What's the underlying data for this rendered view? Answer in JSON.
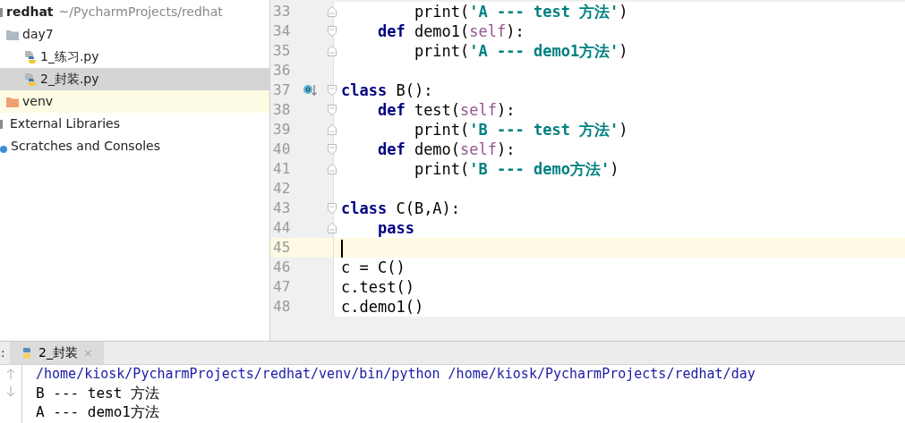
{
  "project_tree": {
    "root": {
      "name": "redhat",
      "path": "~/PycharmProjects/redhat"
    },
    "items": [
      {
        "kind": "folder",
        "label": "day7",
        "selected": false,
        "children": [
          {
            "kind": "python-file",
            "label": "1_练习.py",
            "selected": false
          },
          {
            "kind": "python-file",
            "label": "2_封装.py",
            "selected": true
          }
        ]
      },
      {
        "kind": "excluded-folder",
        "label": "venv",
        "selected": false
      },
      {
        "kind": "libraries",
        "label": "External Libraries",
        "selected": false
      },
      {
        "kind": "scratches",
        "label": "Scratches and Consoles",
        "selected": false
      }
    ]
  },
  "editor": {
    "lines": [
      {
        "number": "33",
        "fold_start": false,
        "fold_end": true,
        "current": false,
        "override": false,
        "tokens": [
          {
            "kind": "plain",
            "text": "        print("
          },
          {
            "kind": "string",
            "text": "'A --- test 方法'"
          },
          {
            "kind": "plain",
            "text": ")"
          }
        ]
      },
      {
        "number": "34",
        "fold_start": true,
        "fold_end": false,
        "current": false,
        "override": false,
        "tokens": [
          {
            "kind": "keyword",
            "text": "    def"
          },
          {
            "kind": "plain",
            "text": " demo1("
          },
          {
            "kind": "self",
            "text": "self"
          },
          {
            "kind": "plain",
            "text": "):"
          }
        ]
      },
      {
        "number": "35",
        "fold_start": false,
        "fold_end": true,
        "current": false,
        "override": false,
        "tokens": [
          {
            "kind": "plain",
            "text": "        print("
          },
          {
            "kind": "string",
            "text": "'A --- demo1方法'"
          },
          {
            "kind": "plain",
            "text": ")"
          }
        ]
      },
      {
        "number": "36",
        "fold_start": false,
        "fold_end": false,
        "current": false,
        "override": false
      },
      {
        "number": "37",
        "fold_start": true,
        "fold_end": false,
        "current": false,
        "override": true,
        "tokens": [
          {
            "kind": "keyword",
            "text": "class"
          },
          {
            "kind": "plain",
            "text": " B():"
          }
        ]
      },
      {
        "number": "38",
        "fold_start": true,
        "fold_end": false,
        "current": false,
        "override": false,
        "tokens": [
          {
            "kind": "keyword",
            "text": "    def"
          },
          {
            "kind": "plain",
            "text": " test("
          },
          {
            "kind": "self",
            "text": "self"
          },
          {
            "kind": "plain",
            "text": "):"
          }
        ]
      },
      {
        "number": "39",
        "fold_start": false,
        "fold_end": true,
        "current": false,
        "override": false,
        "tokens": [
          {
            "kind": "plain",
            "text": "        print("
          },
          {
            "kind": "string",
            "text": "'B --- test 方法'"
          },
          {
            "kind": "plain",
            "text": ")"
          }
        ]
      },
      {
        "number": "40",
        "fold_start": true,
        "fold_end": false,
        "current": false,
        "override": false,
        "tokens": [
          {
            "kind": "keyword",
            "text": "    def"
          },
          {
            "kind": "plain",
            "text": " demo("
          },
          {
            "kind": "self",
            "text": "self"
          },
          {
            "kind": "plain",
            "text": "):"
          }
        ]
      },
      {
        "number": "41",
        "fold_start": false,
        "fold_end": true,
        "current": false,
        "override": false,
        "tokens": [
          {
            "kind": "plain",
            "text": "        print("
          },
          {
            "kind": "string",
            "text": "'B --- demo方法'"
          },
          {
            "kind": "plain",
            "text": ")"
          }
        ]
      },
      {
        "number": "42",
        "fold_start": false,
        "fold_end": false,
        "current": false,
        "override": false
      },
      {
        "number": "43",
        "fold_start": true,
        "fold_end": false,
        "current": false,
        "override": false,
        "tokens": [
          {
            "kind": "keyword",
            "text": "class"
          },
          {
            "kind": "plain",
            "text": " C(B,A):"
          }
        ]
      },
      {
        "number": "44",
        "fold_start": false,
        "fold_end": true,
        "current": false,
        "override": false,
        "tokens": [
          {
            "kind": "keyword",
            "text": "    pass"
          }
        ]
      },
      {
        "number": "45",
        "fold_start": false,
        "fold_end": false,
        "current": true,
        "override": false
      },
      {
        "number": "46",
        "fold_start": false,
        "fold_end": false,
        "current": false,
        "override": false,
        "tokens": [
          {
            "kind": "plain",
            "text": "c = C()"
          }
        ]
      },
      {
        "number": "47",
        "fold_start": false,
        "fold_end": false,
        "current": false,
        "override": false,
        "tokens": [
          {
            "kind": "plain",
            "text": "c.test()"
          }
        ]
      },
      {
        "number": "48",
        "fold_start": false,
        "fold_end": false,
        "current": false,
        "override": false,
        "tokens": [
          {
            "kind": "plain",
            "text": "c.demo1()"
          }
        ]
      }
    ]
  },
  "run_panel": {
    "label": ":",
    "tabs": [
      {
        "label": "2_封装",
        "close": "×",
        "selected": true
      }
    ],
    "output": [
      {
        "kind": "command",
        "text": "/home/kiosk/PycharmProjects/redhat/venv/bin/python /home/kiosk/PycharmProjects/redhat/day"
      },
      {
        "kind": "stdout",
        "text": "B --- test 方法"
      },
      {
        "kind": "stdout",
        "text": "A --- demo1方法"
      }
    ]
  }
}
